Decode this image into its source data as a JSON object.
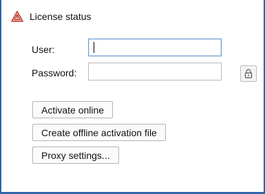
{
  "panel": {
    "title": "License status",
    "app_icon": "warning-triangle-icon"
  },
  "form": {
    "user_label": "User:",
    "user_value": "",
    "password_label": "Password:",
    "password_value": "",
    "lock_icon": "lock-icon"
  },
  "buttons": {
    "activate_online": "Activate online",
    "create_offline": "Create offline activation file",
    "proxy_settings": "Proxy settings..."
  },
  "colors": {
    "frame_border": "#2d66a8",
    "icon_red": "#c0392b"
  }
}
